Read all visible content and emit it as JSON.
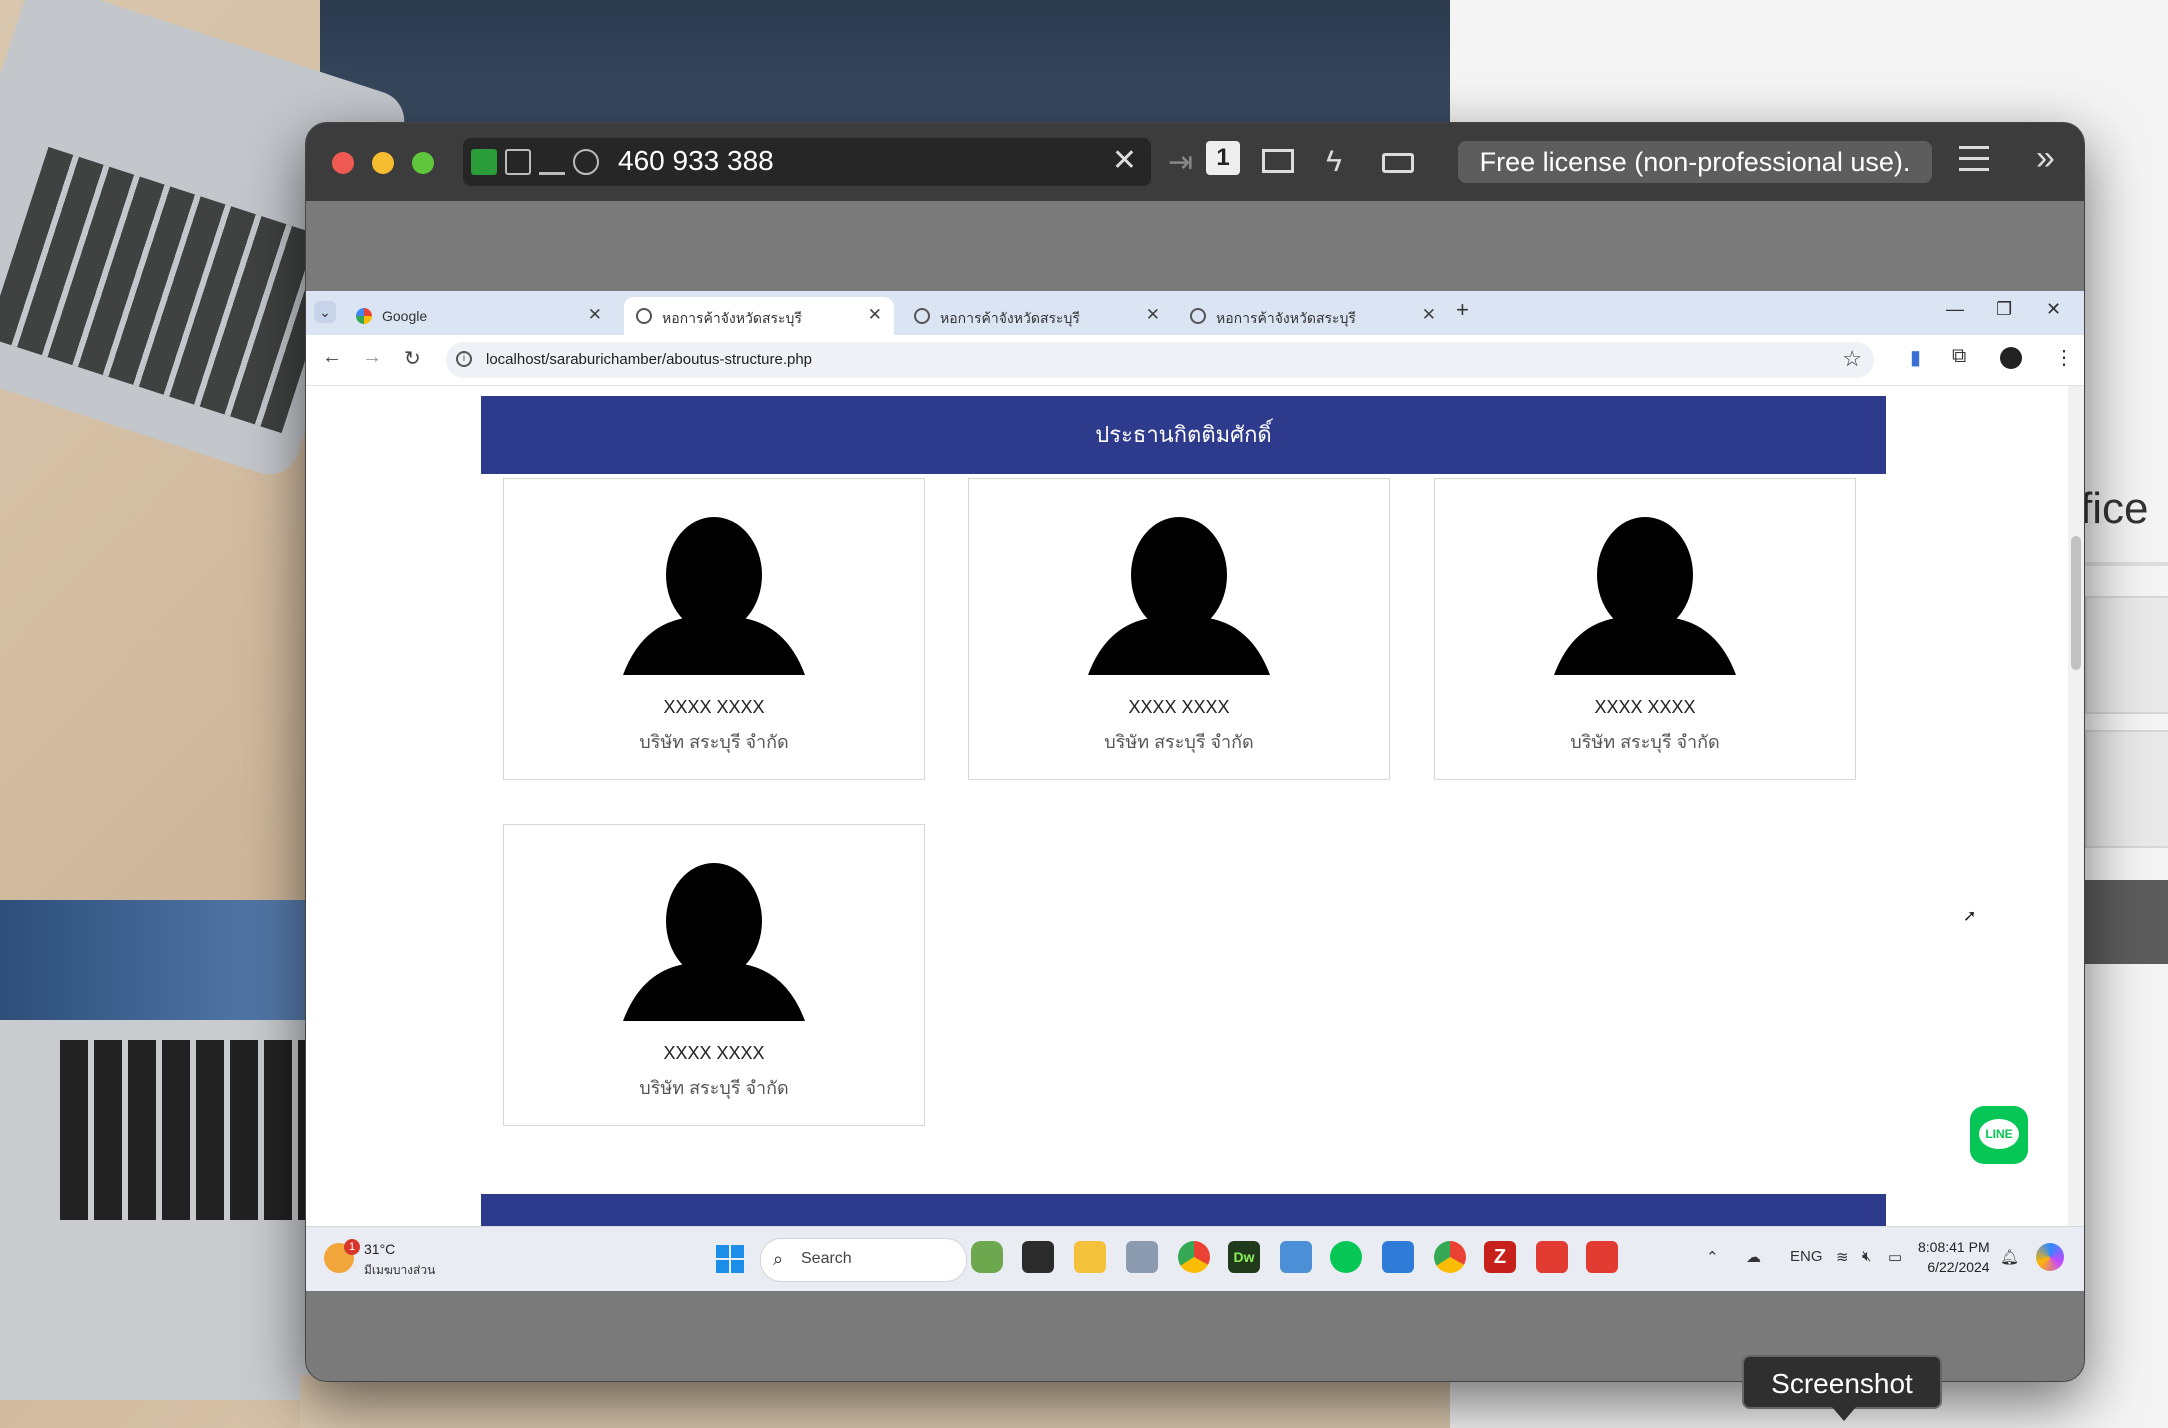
{
  "viewer": {
    "connection_id": "460 933 388",
    "license_label": "Free license (non-professional use).",
    "session_number": "1",
    "tooltip": "Screenshot"
  },
  "browser": {
    "tabs": [
      {
        "label": "Google",
        "active": false
      },
      {
        "label": "หอการค้าจังหวัดสระบุรี",
        "active": true
      },
      {
        "label": "หอการค้าจังหวัดสระบุรี",
        "active": false
      },
      {
        "label": "หอการค้าจังหวัดสระบุรี",
        "active": false
      }
    ],
    "url": "localhost/saraburichamber/aboutus-structure.php"
  },
  "page": {
    "banner_title": "ประธานกิตติมศักดิ์",
    "members": [
      {
        "name": "XXXX XXXX",
        "company": "บริษัท สระบุรี จำกัด"
      },
      {
        "name": "XXXX XXXX",
        "company": "บริษัท สระบุรี จำกัด"
      },
      {
        "name": "XXXX XXXX",
        "company": "บริษัท สระบุรี จำกัด"
      },
      {
        "name": "XXXX XXXX",
        "company": "บริษัท สระบุรี จำกัด"
      }
    ],
    "line_button": "LINE"
  },
  "taskbar": {
    "weather_temp": "31°C",
    "weather_desc": "มีเมฆบางส่วน",
    "weather_badge": "1",
    "search_label": "Search",
    "language": "ENG",
    "time": "8:08:41 PM",
    "date": "6/22/2024"
  },
  "background": {
    "right_text": "fice"
  },
  "colors": {
    "banner": "#2e3a8c",
    "line_green": "#06c755",
    "viewer_bar": "#3c3c3c"
  }
}
